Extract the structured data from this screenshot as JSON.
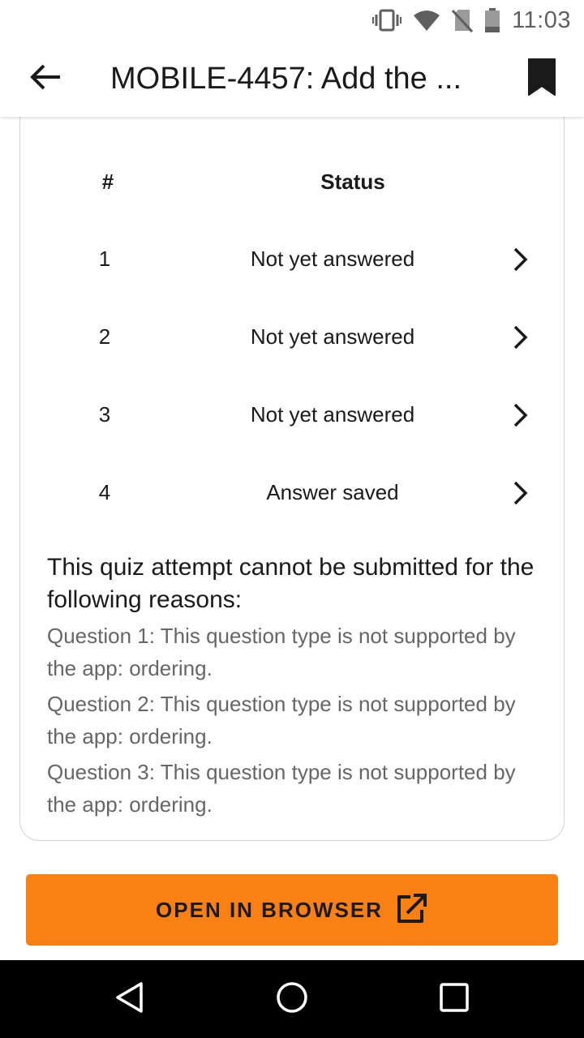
{
  "status_bar": {
    "time": "11:03",
    "icons": [
      "vibrate-icon",
      "wifi-icon",
      "no-sim-icon",
      "battery-icon"
    ]
  },
  "header": {
    "back_icon": "arrow-left-icon",
    "title": "MOBILE-4457: Add the ...",
    "bookmark_icon": "bookmark-icon"
  },
  "table": {
    "col_number": "#",
    "col_status": "Status",
    "rows": [
      {
        "number": "1",
        "status": "Not yet answered"
      },
      {
        "number": "2",
        "status": "Not yet answered"
      },
      {
        "number": "3",
        "status": "Not yet answered"
      },
      {
        "number": "4",
        "status": "Answer saved"
      }
    ]
  },
  "reasons": {
    "title": "This quiz attempt cannot be submitted for the following reasons:",
    "items": [
      "Question 1: This question type is not supported by the app: ordering.",
      "Question 2: This question type is not supported by the app: ordering.",
      "Question 3: This question type is not supported by the app: ordering."
    ]
  },
  "open_browser": {
    "label": "OPEN IN BROWSER",
    "icon": "external-link-icon"
  },
  "colors": {
    "accent": "#f98012",
    "secondary_text": "#666666",
    "nav_bar": "#000000"
  },
  "nav_bar": {
    "back_icon": "nav-back-triangle-icon",
    "home_icon": "nav-home-circle-icon",
    "recents_icon": "nav-recents-square-icon"
  }
}
